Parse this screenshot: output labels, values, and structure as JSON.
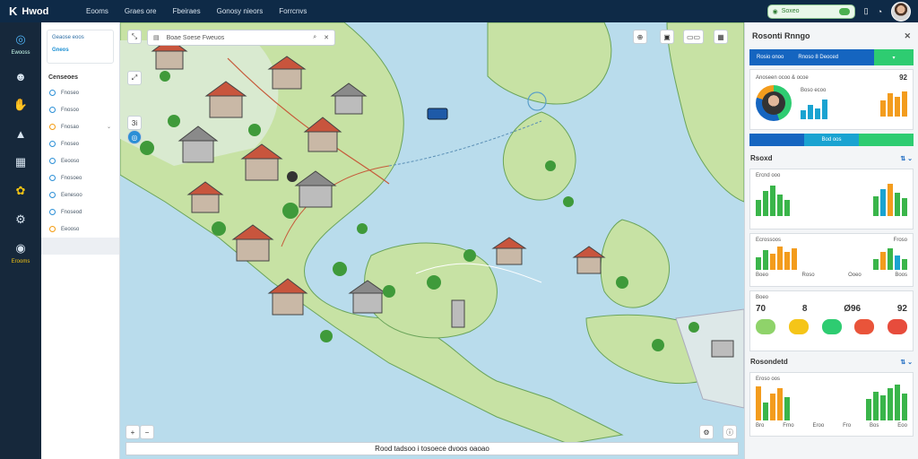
{
  "app": {
    "name": "Hwod"
  },
  "topnav": [
    "Eooms",
    "Graes ore",
    "Fbeiraes",
    "Gonosy nieors",
    "Forrcnvs"
  ],
  "topright": {
    "search_label": "Soxeo"
  },
  "rail": [
    {
      "icon": "globe-icon",
      "label": "Ewooss"
    },
    {
      "icon": "people-icon",
      "label": ""
    },
    {
      "icon": "hand-icon",
      "label": ""
    },
    {
      "icon": "chart-icon",
      "label": ""
    },
    {
      "icon": "grid-icon",
      "label": ""
    },
    {
      "icon": "gear-icon",
      "label": ""
    },
    {
      "icon": "settings-icon",
      "label": ""
    },
    {
      "icon": "layers-icon",
      "label": "Erooms"
    }
  ],
  "sidepanel": {
    "head_line1": "Geaose eoos",
    "head_line2": "Gneos",
    "title": "Censeoes",
    "items": [
      "Fnoseo",
      "Fnosoo",
      "Fnosao",
      "Fnoseo",
      "Eeooso",
      "Fnosoeo",
      "Eenesoo",
      "Fnoseod",
      "Eeooso"
    ]
  },
  "map": {
    "toolbar_text": "Boae Soese Fweuos",
    "zoom_label": "3i",
    "status_text": "Rood tadsoo i tosoece dvoos oaoao"
  },
  "rightpanel": {
    "title": "Rosonti Rnngo",
    "tabs": [
      "Rosio onoo",
      "Rnoso 8 Deoced"
    ],
    "overview_label": "Anoseen ocoo & ocoe",
    "overview_num": "92",
    "overview_sub": "Boso ecoo",
    "progress_text": "Bod oos",
    "card2_title": "Rsoxd",
    "card2_sub": "Ercnd ooo",
    "card3_sub1": "Ecrossoos",
    "card3_sub2": "Froso",
    "card3_axis": [
      "Boeo",
      "Roso",
      "Ooeo",
      "Boos"
    ],
    "card4_label": "Boeo",
    "kpis": [
      "70",
      "8",
      "Ø96",
      "92"
    ],
    "card5_title": "Rosondetd",
    "card5_sub": "Eroso oos",
    "card5_axis": [
      "Bro",
      "Frno",
      "Eroo",
      "Fro",
      "Bos",
      "Eoo"
    ]
  },
  "colors": {
    "topbar": "#0e2a47",
    "accent_blue": "#1565c0",
    "accent_green": "#2ecc71",
    "bar_green": "#3ab54a",
    "bar_orange": "#f39c1d",
    "bar_teal": "#1aa3d1",
    "land": "#c7e2a4",
    "water": "#b9dcec"
  }
}
